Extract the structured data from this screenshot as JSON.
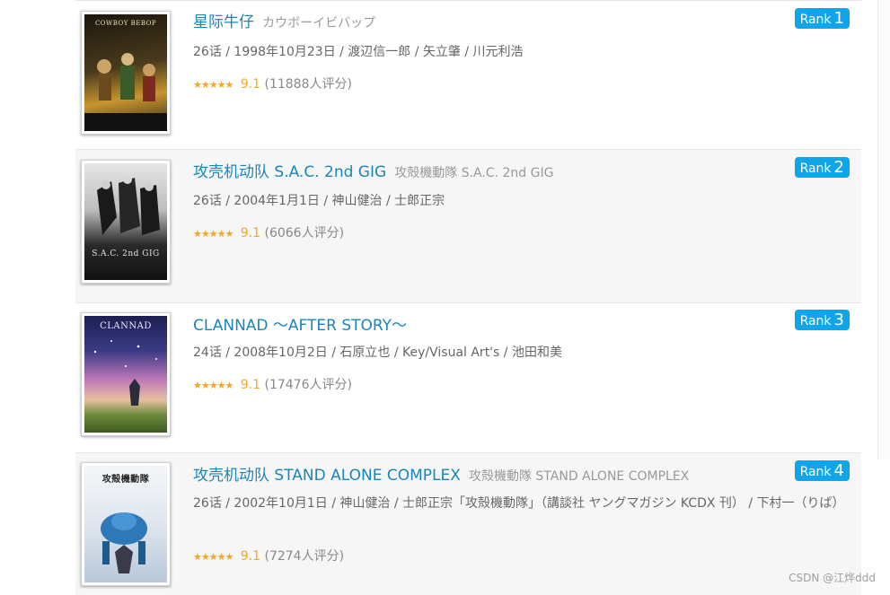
{
  "items": [
    {
      "title": "星际牛仔",
      "original_title": "カウボーイビバップ",
      "meta": "26话 / 1998年10月23日 / 渡辺信一郎 / 矢立肇 / 川元利浩",
      "stars": "★★★★★",
      "score": "9.1",
      "votes": "(11888人评分)",
      "rank_label": "Rank",
      "rank_num": "1",
      "poster_caption": "COWBOY BEBOP",
      "poster_colors": [
        "#2a2418",
        "#c8952e"
      ]
    },
    {
      "title": "攻壳机动队 S.A.C. 2nd GIG",
      "original_title": "攻殻機動隊 S.A.C. 2nd GIG",
      "meta": "26话 / 2004年1月1日 / 神山健治 / 士郎正宗",
      "stars": "★★★★★",
      "score": "9.1",
      "votes": "(6066人评分)",
      "rank_label": "Rank",
      "rank_num": "2",
      "poster_caption": "S.A.C. 2nd GIG",
      "poster_colors": [
        "#d8d8d8",
        "#1c1c1c"
      ]
    },
    {
      "title": "CLANNAD ～AFTER STORY～",
      "original_title": "",
      "meta": "24话 / 2008年10月2日 / 石原立也 / Key/Visual Art's / 池田和美",
      "stars": "★★★★★",
      "score": "9.1",
      "votes": "(17476人评分)",
      "rank_label": "Rank",
      "rank_num": "3",
      "poster_caption": "CLANNAD",
      "poster_colors": [
        "#2c2a66",
        "#d9a0c8"
      ]
    },
    {
      "title": "攻壳机动队 STAND ALONE COMPLEX",
      "original_title": "攻殻機動隊 STAND ALONE COMPLEX",
      "meta": "26话 / 2002年10月1日 / 神山健治 / 士郎正宗「攻殻機動隊」（講談社 ヤングマガジン KCDX 刊） / 下村一（りば）",
      "stars": "★★★★★",
      "score": "9.1",
      "votes": "(7274人评分)",
      "rank_label": "Rank",
      "rank_num": "4",
      "poster_caption": "攻殻機動隊",
      "poster_colors": [
        "#eef2f6",
        "#2f78b8"
      ]
    }
  ],
  "watermark": "CSDN @江烨ddd",
  "colors": {
    "title_link": "#1a85b8",
    "rank_badge": "#0ea5ea",
    "star": "#f5a623"
  }
}
